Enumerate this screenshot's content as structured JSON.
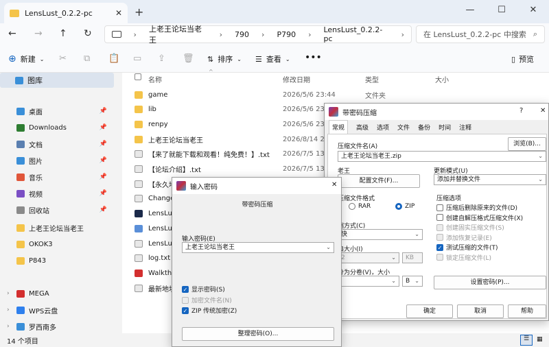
{
  "window": {
    "tab_title": "LensLust_0.2.2-pc",
    "new_tab": "+",
    "controls": [
      "—",
      "☐",
      "✕"
    ]
  },
  "address": {
    "crumbs": [
      "上老王论坛当老王",
      "790",
      "P790",
      "LensLust_0.2.2-pc"
    ],
    "search_placeholder": "在 LensLust_0.2.2-pc 中搜索"
  },
  "toolbar": {
    "new_label": "新建",
    "sort_label": "排序",
    "view_label": "查看",
    "more_label": "•••",
    "preview_label": "预览"
  },
  "sidebar": {
    "gallery": "图库",
    "pinned": [
      {
        "label": "桌面",
        "color": "#3a8fd8"
      },
      {
        "label": "Downloads",
        "color": "#2e7d32"
      },
      {
        "label": "文档",
        "color": "#5a7fb0"
      },
      {
        "label": "图片",
        "color": "#3a8fd8"
      },
      {
        "label": "音乐",
        "color": "#e0563a"
      },
      {
        "label": "视频",
        "color": "#7b4fc4"
      },
      {
        "label": "回收站",
        "color": "#8a8a8a"
      }
    ],
    "folders": [
      "上老王论坛当老王",
      "OKOK3",
      "P843"
    ],
    "drives": [
      {
        "label": "MEGA",
        "color": "#d32f2f"
      },
      {
        "label": "WPS云盘",
        "color": "#2f80ed"
      },
      {
        "label": "罗西南多",
        "color": "#3a8fd8"
      }
    ]
  },
  "columns": {
    "name": "名称",
    "date": "修改日期",
    "type": "类型",
    "size": "大小"
  },
  "files": [
    {
      "name": "game",
      "date": "2026/5/6 23:44",
      "type": "文件夹",
      "color": "#f4c44a"
    },
    {
      "name": "lib",
      "date": "2026/5/6 23:44",
      "type": "",
      "color": "#f4c44a"
    },
    {
      "name": "renpy",
      "date": "2026/5/6 23:44",
      "type": "",
      "color": "#f4c44a"
    },
    {
      "name": "上老王论坛当老王",
      "date": "2026/8/14 20",
      "type": "",
      "color": "#f4c44a"
    },
    {
      "name": "【来了就能下载和观看！纯免费！】.txt",
      "date": "2026/7/5 13:1",
      "type": "",
      "color": "#e8e8e8"
    },
    {
      "name": "【论坛介绍】.txt",
      "date": "2026/7/5 13:1",
      "type": "",
      "color": "#e8e8e8"
    },
    {
      "name": "【永久地",
      "date": "",
      "type": "",
      "color": "#e8e8e8"
    },
    {
      "name": "Change",
      "date": "",
      "type": "",
      "color": "#e8e8e8"
    },
    {
      "name": "LensLu",
      "date": "",
      "type": "",
      "color": "#1b2a4a"
    },
    {
      "name": "LensLu",
      "date": "",
      "type": "",
      "color": "#5a8fd8"
    },
    {
      "name": "LensLu",
      "date": "",
      "type": "",
      "color": "#e8e8e8"
    },
    {
      "name": "log.txt",
      "date": "",
      "type": "",
      "color": "#e8e8e8"
    },
    {
      "name": "Walkthr",
      "date": "",
      "type": "",
      "color": "#d32f2f"
    },
    {
      "name": "最新地址",
      "date": "",
      "type": "",
      "color": "#e8e8e8"
    }
  ],
  "status": {
    "count": "14 个项目"
  },
  "rar_dialog": {
    "title": "带密码压缩",
    "help": "?",
    "close": "✕",
    "tabs": [
      "常规",
      "高级",
      "选项",
      "文件",
      "备份",
      "时间",
      "注释"
    ],
    "archive_name_label": "压缩文件名(A)",
    "browse": "浏览(B)...",
    "archive_name": "上老王论坛当老王.zip",
    "profile_label": "老王",
    "profile_button": "配置文件(F)...",
    "update_mode_label": "更新模式(U)",
    "update_mode": "添加并替换文件",
    "format_label": "压缩文件格式",
    "format_rar": "RAR",
    "format_zip": "ZIP",
    "method_label": "缩方式(C)",
    "method": "快",
    "dict_label": "典大小(I)",
    "dict_value": "2",
    "dict_unit": "KB",
    "split_label": "分为分卷(V)，大小",
    "split_unit": "B",
    "options_title": "压缩选项",
    "options": [
      {
        "label": "压缩后删除原来的文件(D)",
        "checked": false,
        "disabled": false
      },
      {
        "label": "创建自解压格式压缩文件(X)",
        "checked": false,
        "disabled": false
      },
      {
        "label": "创建固实压缩文件(S)",
        "checked": false,
        "disabled": true
      },
      {
        "label": "添加恢复记录(E)",
        "checked": false,
        "disabled": true
      },
      {
        "label": "测试压缩的文件(T)",
        "checked": true,
        "disabled": false
      },
      {
        "label": "锁定压缩文件(L)",
        "checked": false,
        "disabled": true
      }
    ],
    "set_password": "设置密码(P)...",
    "ok": "确定",
    "cancel": "取消",
    "help_button": "帮助"
  },
  "pwd_dialog": {
    "title": "输入密码",
    "close": "✕",
    "subtitle": "带密码压缩",
    "input_label": "输入密码(E)",
    "password": "上老王论坛当老王",
    "show_password": "显示密码(S)",
    "encrypt_names": "加密文件名(N)",
    "zip_legacy": "ZIP 传统加密(Z)",
    "organize": "整理密码(O)..."
  }
}
